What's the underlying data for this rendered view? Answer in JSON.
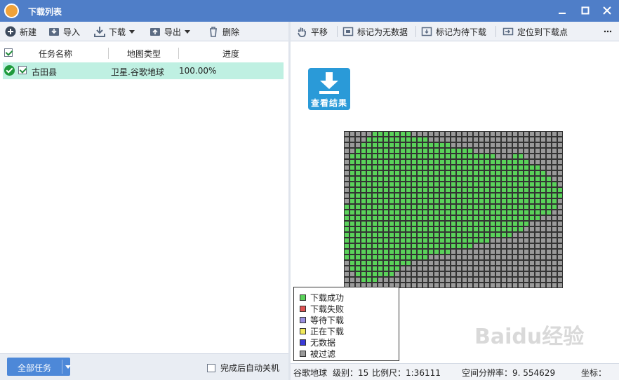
{
  "window": {
    "title": "下载列表"
  },
  "toolbar_left": {
    "new_label": "新建",
    "import_label": "导入",
    "download_label": "下载",
    "export_label": "导出",
    "delete_label": "删除"
  },
  "toolbar_right": {
    "pan_label": "平移",
    "mark_nodata_label": "标记为无数据",
    "mark_pending_label": "标记为待下载",
    "locate_label": "定位到下载点",
    "more_label": "⋯"
  },
  "task_list": {
    "headers": {
      "name": "任务名称",
      "map_type": "地图类型",
      "progress": "进度"
    },
    "rows": [
      {
        "name": "古田县",
        "map_type": "卫星.谷歌地球",
        "progress": "100.00%"
      }
    ]
  },
  "bottom": {
    "all_tasks_label": "全部任务",
    "auto_shutdown_label": "完成后自动关机"
  },
  "map": {
    "view_result_label": "查看结果"
  },
  "legend": {
    "items": [
      {
        "label": "下载成功",
        "color": "#5ad25a"
      },
      {
        "label": "下载失败",
        "color": "#e05252"
      },
      {
        "label": "等待下载",
        "color": "#9a8fe0"
      },
      {
        "label": "正在下载",
        "color": "#f2ea5a"
      },
      {
        "label": "无数据",
        "color": "#3a3ad8"
      },
      {
        "label": "被过滤",
        "color": "#9a9a9a"
      }
    ]
  },
  "status": {
    "source": "谷歌地球",
    "level_text": "级别：15",
    "scale_text": "比例尺：1:36111",
    "resolution_text": "空间分辨率：9. 554629",
    "coord_text": "坐标："
  },
  "colors": {
    "titlebar": "#4f7ec8",
    "row_selected": "#bff0e2",
    "tile_success": "#5ad25a",
    "tile_filtered": "#9a9a9a",
    "accent_button": "#4d88d8"
  },
  "watermark": "Baidu经验"
}
